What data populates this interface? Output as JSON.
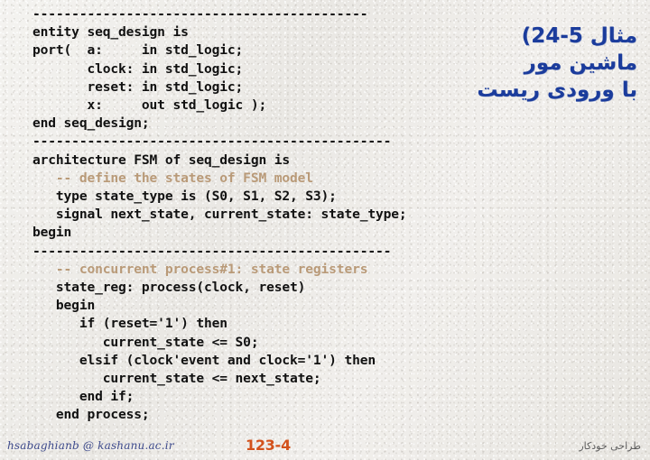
{
  "slide": {
    "background_color": "#eceae6",
    "code_color": "#111111",
    "comment_color": "#b99a78",
    "title_color": "#1b3c9c",
    "page_number_color": "#d3521c"
  },
  "title": {
    "lines": [
      "مثال 5-24)",
      "ماشین مور",
      "با ورودی ریست"
    ]
  },
  "code": {
    "lines": [
      {
        "text": "-------------------------------------------",
        "style": "plain"
      },
      {
        "text": "entity seq_design is",
        "style": "plain"
      },
      {
        "text": "port(  a:     in std_logic;",
        "style": "plain"
      },
      {
        "text": "       clock: in std_logic;",
        "style": "plain"
      },
      {
        "text": "       reset: in std_logic;",
        "style": "plain"
      },
      {
        "text": "       x:     out std_logic );",
        "style": "plain"
      },
      {
        "text": "end seq_design;",
        "style": "plain"
      },
      {
        "text": "----------------------------------------------",
        "style": "plain"
      },
      {
        "text": "architecture FSM of seq_design is",
        "style": "plain"
      },
      {
        "text": "   -- define the states of FSM model",
        "style": "comment"
      },
      {
        "text": "   type state_type is (S0, S1, S2, S3);",
        "style": "plain"
      },
      {
        "text": "   signal next_state, current_state: state_type;",
        "style": "plain"
      },
      {
        "text": "begin",
        "style": "plain"
      },
      {
        "text": "----------------------------------------------",
        "style": "plain"
      },
      {
        "text": "   -- concurrent process#1: state registers",
        "style": "comment"
      },
      {
        "text": "   state_reg: process(clock, reset)",
        "style": "plain"
      },
      {
        "text": "   begin",
        "style": "plain"
      },
      {
        "text": "      if (reset='1') then",
        "style": "plain"
      },
      {
        "text": "         current_state <= S0;",
        "style": "plain"
      },
      {
        "text": "      elsif (clock'event and clock='1') then",
        "style": "plain"
      },
      {
        "text": "         current_state <= next_state;",
        "style": "plain"
      },
      {
        "text": "      end if;",
        "style": "plain"
      },
      {
        "text": "   end process;",
        "style": "plain"
      }
    ]
  },
  "footer": {
    "email": "hsabaghianb @ kashanu.ac.ir",
    "page_number": "123",
    "page_suffix": "-4",
    "right_text": "طراحی خودکار"
  }
}
